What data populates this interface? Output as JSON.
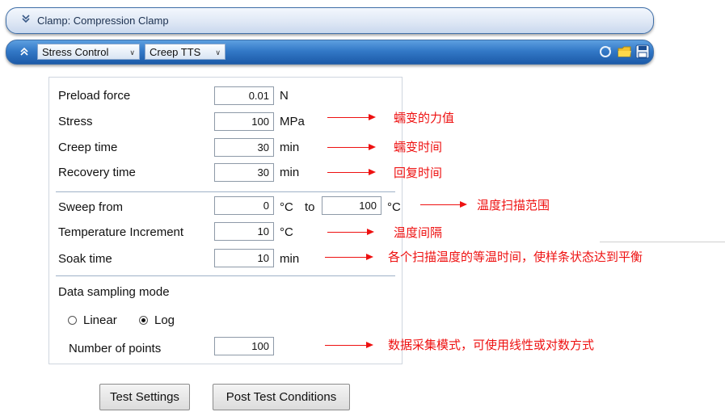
{
  "clamp_bar": {
    "title": "Clamp: Compression Clamp"
  },
  "method_bar": {
    "control_mode": "Stress Control",
    "test_type": "Creep TTS"
  },
  "form": {
    "preload_force": {
      "label": "Preload force",
      "value": "0.01",
      "unit": "N"
    },
    "stress": {
      "label": "Stress",
      "value": "100",
      "unit": "MPa"
    },
    "creep_time": {
      "label": "Creep time",
      "value": "30",
      "unit": "min"
    },
    "recovery_time": {
      "label": "Recovery time",
      "value": "30",
      "unit": "min"
    },
    "sweep": {
      "label": "Sweep from",
      "from": "0",
      "from_unit": "°C",
      "to_label": "to",
      "to": "100",
      "to_unit": "°C"
    },
    "temp_increment": {
      "label": "Temperature Increment",
      "value": "10",
      "unit": "°C"
    },
    "soak_time": {
      "label": "Soak time",
      "value": "10",
      "unit": "min"
    },
    "sampling": {
      "label": "Data sampling mode",
      "options": [
        "Linear",
        "Log"
      ],
      "selected": "Log",
      "points_label": "Number of points",
      "points_value": "100"
    }
  },
  "buttons": {
    "test_settings": "Test Settings",
    "post_test": "Post Test Conditions"
  },
  "annotations": {
    "stress": "蠕变的力值",
    "creep_time": "蠕变时间",
    "recovery_time": "回复时间",
    "sweep": "温度扫描范围",
    "temp_increment": "温度间隔",
    "soak_time": "各个扫描温度的等温时间，使样条状态达到平衡",
    "points": "数据采集模式，可使用线性或对数方式"
  },
  "icons": [
    "refresh-icon",
    "folder-icon",
    "save-icon"
  ],
  "colors": {
    "accent_bar": "#3379c7",
    "annotation": "#e11111"
  }
}
